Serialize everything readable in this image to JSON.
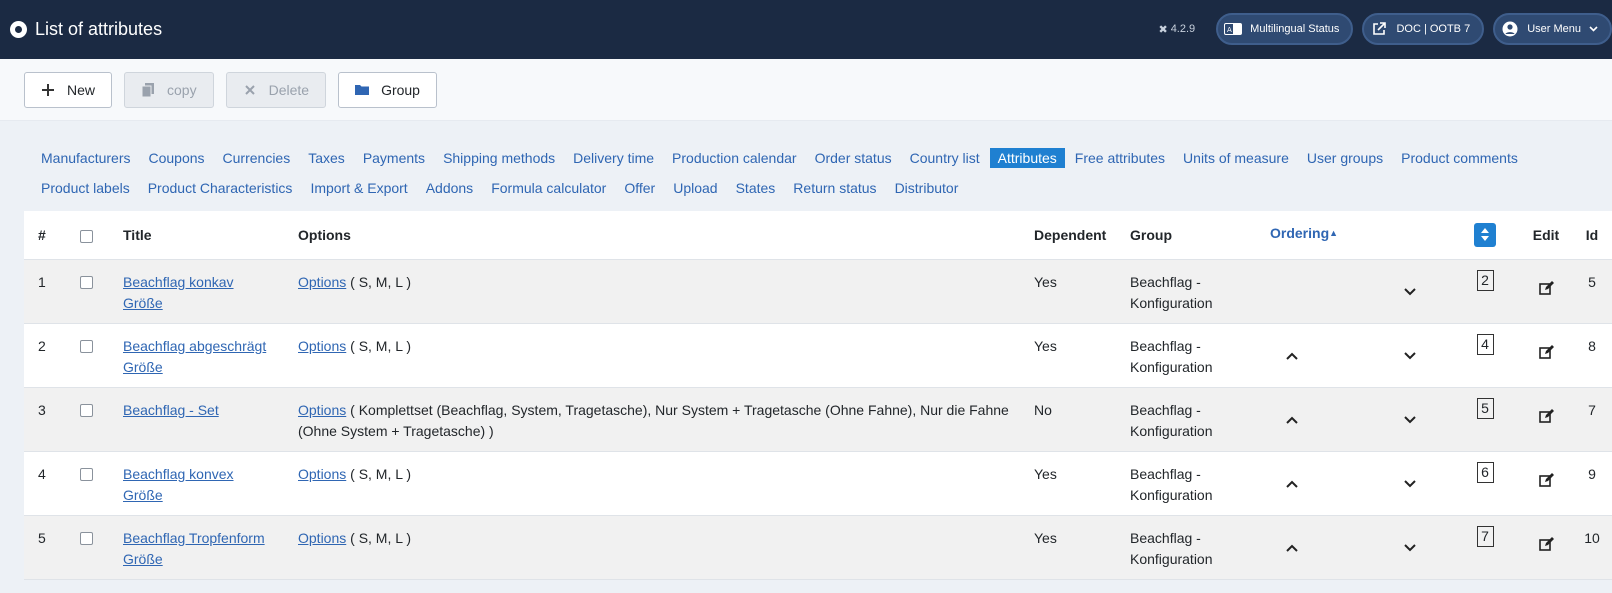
{
  "header": {
    "title": "List of attributes",
    "version": "4.2.9",
    "pills": [
      {
        "label": "Multilingual Status"
      },
      {
        "label": "DOC | OOTB 7"
      },
      {
        "label": "User Menu"
      }
    ]
  },
  "toolbar": {
    "new": "New",
    "copy": "copy",
    "delete": "Delete",
    "group": "Group"
  },
  "submenu": {
    "row1": [
      "Manufacturers",
      "Coupons",
      "Currencies",
      "Taxes",
      "Payments",
      "Shipping methods",
      "Delivery time",
      "Production calendar",
      "Order status",
      "Country list",
      "Attributes",
      "Free attributes",
      "Units of measure",
      "User groups",
      "Product comments"
    ],
    "row2": [
      "Product labels",
      "Product Characteristics",
      "Import & Export",
      "Addons",
      "Formula calculator",
      "Offer",
      "Upload",
      "States",
      "Return status",
      "Distributor"
    ],
    "active": "Attributes"
  },
  "table": {
    "headers": {
      "num": "#",
      "title": "Title",
      "options": "Options",
      "dependent": "Dependent",
      "group": "Group",
      "ordering": "Ordering",
      "edit": "Edit",
      "id": "Id"
    },
    "rows": [
      {
        "num": "1",
        "title_l1": "Beachflag konkav",
        "title_l2": "Größe",
        "options_link": "Options",
        "options_text": " ( S, M, L )",
        "options_text2": "",
        "dependent": "Yes",
        "group_l1": "Beachflag -",
        "group_l2": "Konfiguration",
        "order": "2",
        "id": "5"
      },
      {
        "num": "2",
        "title_l1": "Beachflag abgeschrägt",
        "title_l2": "Größe",
        "options_link": "Options",
        "options_text": " ( S, M, L )",
        "options_text2": "",
        "dependent": "Yes",
        "group_l1": "Beachflag -",
        "group_l2": "Konfiguration",
        "order": "4",
        "id": "8"
      },
      {
        "num": "3",
        "title_l1": "Beachflag - Set",
        "title_l2": "",
        "options_link": "Options",
        "options_text": " ( Komplettset (Beachflag, System, Tragetasche), Nur System + Tragetasche (Ohne Fahne), Nur die Fahne",
        "options_text2": "(Ohne System + Tragetasche) )",
        "dependent": "No",
        "group_l1": "Beachflag -",
        "group_l2": "Konfiguration",
        "order": "5",
        "id": "7"
      },
      {
        "num": "4",
        "title_l1": "Beachflag konvex",
        "title_l2": "Größe",
        "options_link": "Options",
        "options_text": " ( S, M, L )",
        "options_text2": "",
        "dependent": "Yes",
        "group_l1": "Beachflag -",
        "group_l2": "Konfiguration",
        "order": "6",
        "id": "9"
      },
      {
        "num": "5",
        "title_l1": "Beachflag Tropfenform",
        "title_l2": "Größe",
        "options_link": "Options",
        "options_text": " ( S, M, L )",
        "options_text2": "",
        "dependent": "Yes",
        "group_l1": "Beachflag -",
        "group_l2": "Konfiguration",
        "order": "7",
        "id": "10"
      }
    ]
  }
}
